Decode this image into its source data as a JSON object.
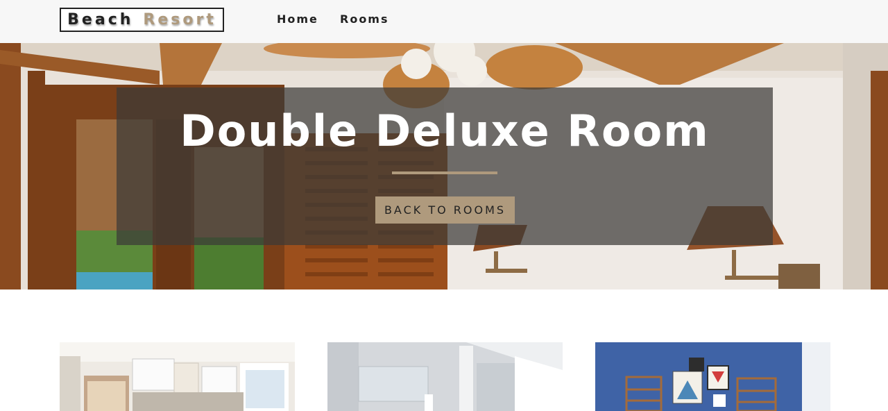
{
  "navbar": {
    "logo_word1": "Beach",
    "logo_word2": "Resort",
    "links": [
      {
        "label": "Home"
      },
      {
        "label": "Rooms"
      }
    ]
  },
  "hero": {
    "title": "Double Deluxe Room",
    "button_label": "BACK TO ROOMS"
  },
  "colors": {
    "accent": "#af9a7d",
    "navbar_bg": "#f7f7f7",
    "banner_bg": "rgba(60,58,56,0.72)"
  }
}
